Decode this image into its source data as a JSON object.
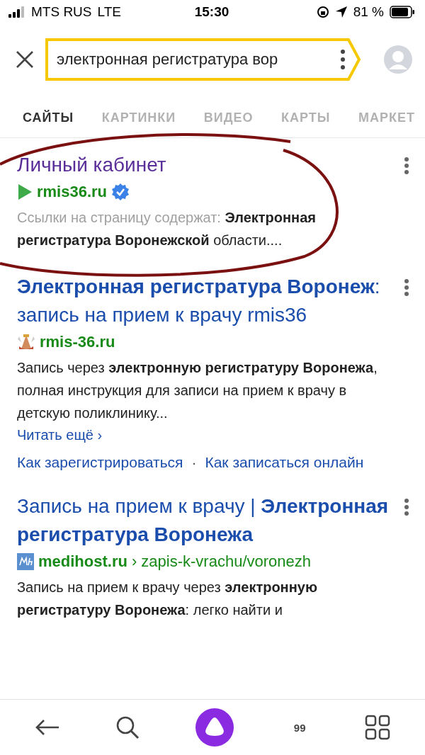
{
  "status_bar": {
    "carrier": "MTS RUS",
    "network": "LTE",
    "time": "15:30",
    "battery": "81 %"
  },
  "search": {
    "value": "электронная регистратура вор"
  },
  "tabs": [
    {
      "label": "САЙТЫ",
      "selected": true
    },
    {
      "label": "КАРТИНКИ",
      "selected": false
    },
    {
      "label": "ВИДЕО",
      "selected": false
    },
    {
      "label": "КАРТЫ",
      "selected": false
    },
    {
      "label": "МАРКЕТ",
      "selected": false
    }
  ],
  "results": [
    {
      "title": "Личный кабинет",
      "visited": true,
      "favicon": {
        "kind": "play"
      },
      "domain": "rmis36.ru",
      "verified": true,
      "snippet_prefix": "Ссылки на страницу содержат:",
      "snippet": "**Электронная регистратура Воронежской** области...."
    },
    {
      "title": "**Электронная регистратура Воронеж**: запись на прием к врачу rmis36",
      "visited": false,
      "favicon": {
        "kind": "crest"
      },
      "domain": "rmis-36.ru",
      "verified": false,
      "snippet": "Запись через **электронную регистратуру Воронежа**, полная инструкция для записи на прием к врачу в детскую поликлинику...",
      "read_more": "Читать ещё ›",
      "sitelinks": [
        "Как зарегистрироваться",
        "Как записаться онлайн"
      ],
      "sitelink_separator": "·"
    },
    {
      "title": "Запись на прием к врачу | **Электронная регистратура Воронежа**",
      "visited": false,
      "favicon": {
        "kind": "mh"
      },
      "domain": "medihost.ru",
      "path": "› zapis-k-vrachu/voronezh",
      "verified": false,
      "snippet": "Запись на прием к врачу через **электронную регистратуру Воронежа**: легко найти и"
    }
  ],
  "bottom_bar": {
    "tabs_count": "99"
  }
}
